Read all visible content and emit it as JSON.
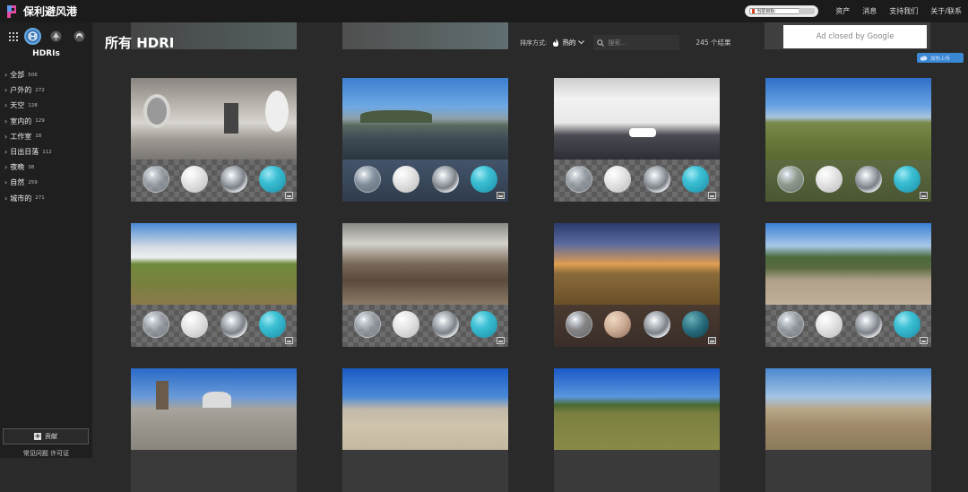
{
  "app": {
    "title": "保利避风港",
    "support_pill_text": "当前目标:",
    "nav": [
      "资产",
      "消息",
      "支持我们",
      "关于/联系"
    ]
  },
  "sidebar": {
    "heading": "HDRIs",
    "categories": [
      {
        "label": "全部",
        "count": "506"
      },
      {
        "label": "户外的",
        "count": "272"
      },
      {
        "label": "天空",
        "count": "128"
      },
      {
        "label": "室内的",
        "count": "129"
      },
      {
        "label": "工作室",
        "count": "18"
      },
      {
        "label": "日出日落",
        "count": "112"
      },
      {
        "label": "夜晚",
        "count": "38"
      },
      {
        "label": "自然",
        "count": "259"
      },
      {
        "label": "城市的",
        "count": "271"
      }
    ],
    "contribute_label": "贡献",
    "faq_label": "常见问题 许可证"
  },
  "main": {
    "page_title": "所有 HDRI",
    "sort_label": "排序方式:",
    "sort_value": "热的",
    "search_placeholder": "搜索...",
    "results": "245 个结果"
  },
  "ad": {
    "text": "Ad closed by Google",
    "button_label": "加热上传"
  },
  "icons": {
    "grid": "grid-icon",
    "hdri": "hdri-category-icon",
    "tree": "tree-icon",
    "helmet": "model-icon",
    "fire": "fire-icon",
    "chevron": "chevron-down-icon",
    "search": "search-icon",
    "image": "image-icon"
  },
  "colors": {
    "accent": "#3a87d4",
    "sphere_color": "#3cc0d4",
    "background": "#2a2a2a",
    "sidebar": "#1f1f1f"
  }
}
